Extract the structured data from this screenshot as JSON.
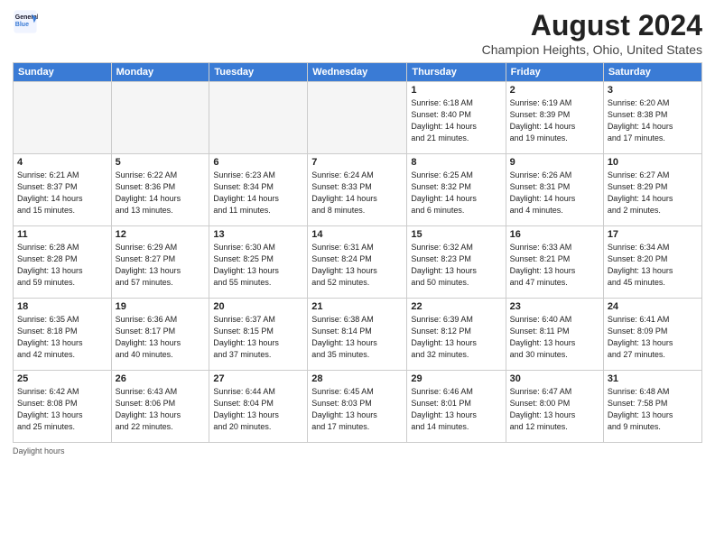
{
  "logo": {
    "line1": "General",
    "line2": "Blue"
  },
  "title": "August 2024",
  "location": "Champion Heights, Ohio, United States",
  "days_of_week": [
    "Sunday",
    "Monday",
    "Tuesday",
    "Wednesday",
    "Thursday",
    "Friday",
    "Saturday"
  ],
  "footer": "Daylight hours",
  "weeks": [
    [
      {
        "day": "",
        "info": "",
        "empty": true
      },
      {
        "day": "",
        "info": "",
        "empty": true
      },
      {
        "day": "",
        "info": "",
        "empty": true
      },
      {
        "day": "",
        "info": "",
        "empty": true
      },
      {
        "day": "1",
        "info": "Sunrise: 6:18 AM\nSunset: 8:40 PM\nDaylight: 14 hours\nand 21 minutes."
      },
      {
        "day": "2",
        "info": "Sunrise: 6:19 AM\nSunset: 8:39 PM\nDaylight: 14 hours\nand 19 minutes."
      },
      {
        "day": "3",
        "info": "Sunrise: 6:20 AM\nSunset: 8:38 PM\nDaylight: 14 hours\nand 17 minutes."
      }
    ],
    [
      {
        "day": "4",
        "info": "Sunrise: 6:21 AM\nSunset: 8:37 PM\nDaylight: 14 hours\nand 15 minutes."
      },
      {
        "day": "5",
        "info": "Sunrise: 6:22 AM\nSunset: 8:36 PM\nDaylight: 14 hours\nand 13 minutes."
      },
      {
        "day": "6",
        "info": "Sunrise: 6:23 AM\nSunset: 8:34 PM\nDaylight: 14 hours\nand 11 minutes."
      },
      {
        "day": "7",
        "info": "Sunrise: 6:24 AM\nSunset: 8:33 PM\nDaylight: 14 hours\nand 8 minutes."
      },
      {
        "day": "8",
        "info": "Sunrise: 6:25 AM\nSunset: 8:32 PM\nDaylight: 14 hours\nand 6 minutes."
      },
      {
        "day": "9",
        "info": "Sunrise: 6:26 AM\nSunset: 8:31 PM\nDaylight: 14 hours\nand 4 minutes."
      },
      {
        "day": "10",
        "info": "Sunrise: 6:27 AM\nSunset: 8:29 PM\nDaylight: 14 hours\nand 2 minutes."
      }
    ],
    [
      {
        "day": "11",
        "info": "Sunrise: 6:28 AM\nSunset: 8:28 PM\nDaylight: 13 hours\nand 59 minutes."
      },
      {
        "day": "12",
        "info": "Sunrise: 6:29 AM\nSunset: 8:27 PM\nDaylight: 13 hours\nand 57 minutes."
      },
      {
        "day": "13",
        "info": "Sunrise: 6:30 AM\nSunset: 8:25 PM\nDaylight: 13 hours\nand 55 minutes."
      },
      {
        "day": "14",
        "info": "Sunrise: 6:31 AM\nSunset: 8:24 PM\nDaylight: 13 hours\nand 52 minutes."
      },
      {
        "day": "15",
        "info": "Sunrise: 6:32 AM\nSunset: 8:23 PM\nDaylight: 13 hours\nand 50 minutes."
      },
      {
        "day": "16",
        "info": "Sunrise: 6:33 AM\nSunset: 8:21 PM\nDaylight: 13 hours\nand 47 minutes."
      },
      {
        "day": "17",
        "info": "Sunrise: 6:34 AM\nSunset: 8:20 PM\nDaylight: 13 hours\nand 45 minutes."
      }
    ],
    [
      {
        "day": "18",
        "info": "Sunrise: 6:35 AM\nSunset: 8:18 PM\nDaylight: 13 hours\nand 42 minutes."
      },
      {
        "day": "19",
        "info": "Sunrise: 6:36 AM\nSunset: 8:17 PM\nDaylight: 13 hours\nand 40 minutes."
      },
      {
        "day": "20",
        "info": "Sunrise: 6:37 AM\nSunset: 8:15 PM\nDaylight: 13 hours\nand 37 minutes."
      },
      {
        "day": "21",
        "info": "Sunrise: 6:38 AM\nSunset: 8:14 PM\nDaylight: 13 hours\nand 35 minutes."
      },
      {
        "day": "22",
        "info": "Sunrise: 6:39 AM\nSunset: 8:12 PM\nDaylight: 13 hours\nand 32 minutes."
      },
      {
        "day": "23",
        "info": "Sunrise: 6:40 AM\nSunset: 8:11 PM\nDaylight: 13 hours\nand 30 minutes."
      },
      {
        "day": "24",
        "info": "Sunrise: 6:41 AM\nSunset: 8:09 PM\nDaylight: 13 hours\nand 27 minutes."
      }
    ],
    [
      {
        "day": "25",
        "info": "Sunrise: 6:42 AM\nSunset: 8:08 PM\nDaylight: 13 hours\nand 25 minutes."
      },
      {
        "day": "26",
        "info": "Sunrise: 6:43 AM\nSunset: 8:06 PM\nDaylight: 13 hours\nand 22 minutes."
      },
      {
        "day": "27",
        "info": "Sunrise: 6:44 AM\nSunset: 8:04 PM\nDaylight: 13 hours\nand 20 minutes."
      },
      {
        "day": "28",
        "info": "Sunrise: 6:45 AM\nSunset: 8:03 PM\nDaylight: 13 hours\nand 17 minutes."
      },
      {
        "day": "29",
        "info": "Sunrise: 6:46 AM\nSunset: 8:01 PM\nDaylight: 13 hours\nand 14 minutes."
      },
      {
        "day": "30",
        "info": "Sunrise: 6:47 AM\nSunset: 8:00 PM\nDaylight: 13 hours\nand 12 minutes."
      },
      {
        "day": "31",
        "info": "Sunrise: 6:48 AM\nSunset: 7:58 PM\nDaylight: 13 hours\nand 9 minutes."
      }
    ]
  ]
}
